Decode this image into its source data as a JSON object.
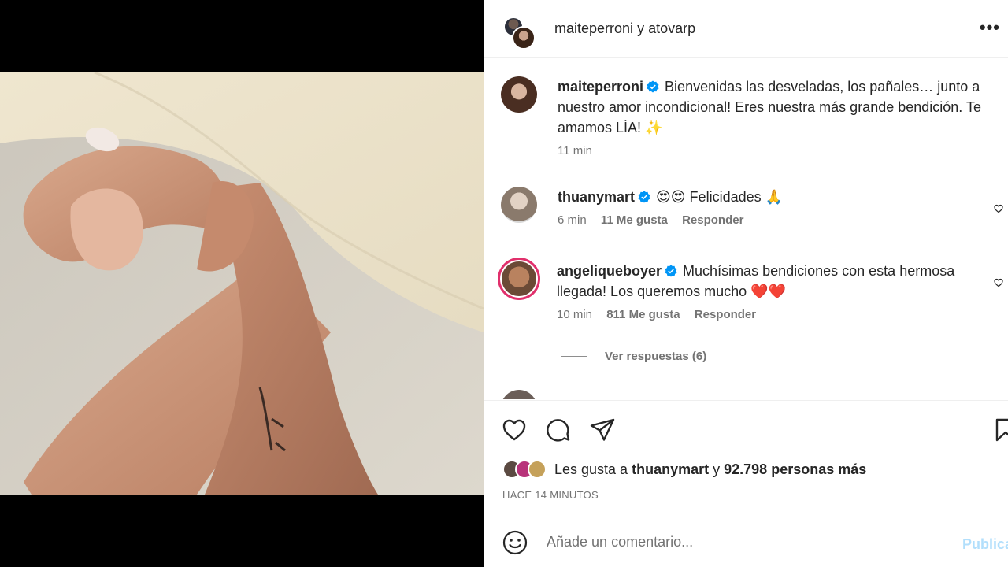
{
  "header": {
    "user1": "maiteperroni",
    "connector": "y",
    "user2": "atovarp",
    "more_icon": "more-horizontal-icon"
  },
  "caption": {
    "username": "maiteperroni",
    "text": "Bienvenidas las desveladas, los pañales… junto a nuestro amor incondicional! Eres nuestra más grande bendición. Te amamos LÍA! ✨",
    "time": "11 min"
  },
  "comments": [
    {
      "username": "thuanymart",
      "text": "😍😍 Felicidades 🙏",
      "time": "6 min",
      "likes": "11 Me gusta",
      "reply": "Responder"
    },
    {
      "username": "angeliqueboyer",
      "text": "Muchísimas bendiciones con esta hermosa llegada! Los queremos mucho ❤️❤️",
      "time": "10 min",
      "likes": "811 Me gusta",
      "reply": "Responder",
      "view_replies": "Ver respuestas (6)"
    }
  ],
  "likes": {
    "prefix": "Les gusta a",
    "user": "thuanymart",
    "middle": "y",
    "count": "92.798 personas más"
  },
  "time_ago": "HACE 14 MINUTOS",
  "add_comment": {
    "placeholder": "Añade un comentario...",
    "publish": "Publica"
  },
  "colors": {
    "verified": "#0095f6",
    "muted": "#737373",
    "publish_disabled": "#b2dffc",
    "story_ring": "#e1306c"
  }
}
